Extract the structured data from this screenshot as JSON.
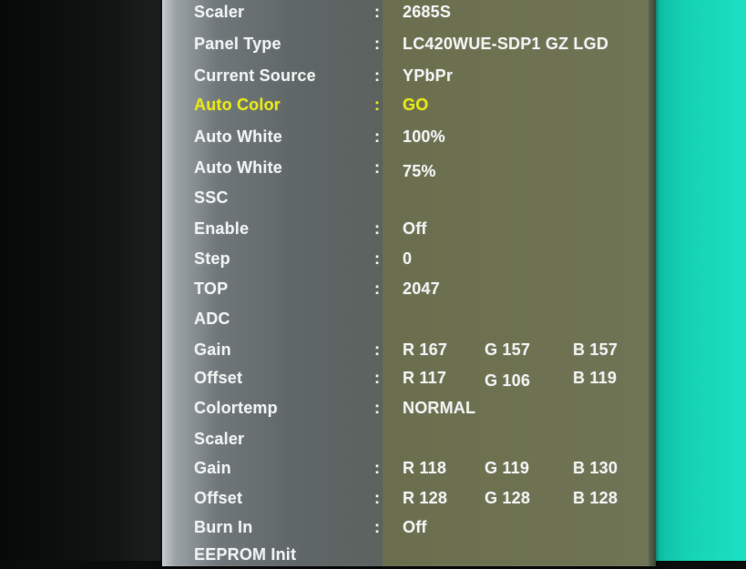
{
  "colors": {
    "text": "#eef1f0",
    "highlight": "#e6e61e",
    "label_panel": "#5f6767",
    "value_panel": "#6d7150",
    "screen_teal": "#16d2b4"
  },
  "menu": {
    "separator": ":",
    "rows": [
      {
        "label": "Scaler",
        "values": [
          "2685S"
        ]
      },
      {
        "label": "Panel Type",
        "values": [
          "LC420WUE-SDP1 GZ LGD"
        ]
      },
      {
        "label": "Current Source",
        "values": [
          "YPbPr"
        ]
      },
      {
        "label": "Auto Color",
        "values": [
          "GO"
        ]
      },
      {
        "label": "Auto White",
        "values": [
          "100%"
        ]
      },
      {
        "label": "Auto White",
        "values": [
          "75%"
        ]
      },
      {
        "label": "SSC",
        "values": []
      },
      {
        "label": "Enable",
        "values": [
          "Off"
        ]
      },
      {
        "label": "Step",
        "values": [
          "0"
        ]
      },
      {
        "label": "TOP",
        "values": [
          "2047"
        ]
      },
      {
        "label": "ADC",
        "values": []
      },
      {
        "label": "Gain",
        "values": [
          "R 167",
          "G 157",
          "B 157"
        ]
      },
      {
        "label": "Offset",
        "values": [
          "R 117",
          "G 106",
          "B 119"
        ]
      },
      {
        "label": "Colortemp",
        "values": [
          "NORMAL"
        ]
      },
      {
        "label": "Scaler",
        "values": []
      },
      {
        "label": "Gain",
        "values": [
          "R 118",
          "G 119",
          "B 130"
        ]
      },
      {
        "label": "Offset",
        "values": [
          "R 128",
          "G 128",
          "B 128"
        ]
      },
      {
        "label": "Burn In",
        "values": [
          "Off"
        ]
      },
      {
        "label": "EEPROM Init",
        "values": []
      }
    ],
    "selected_index": 3
  }
}
